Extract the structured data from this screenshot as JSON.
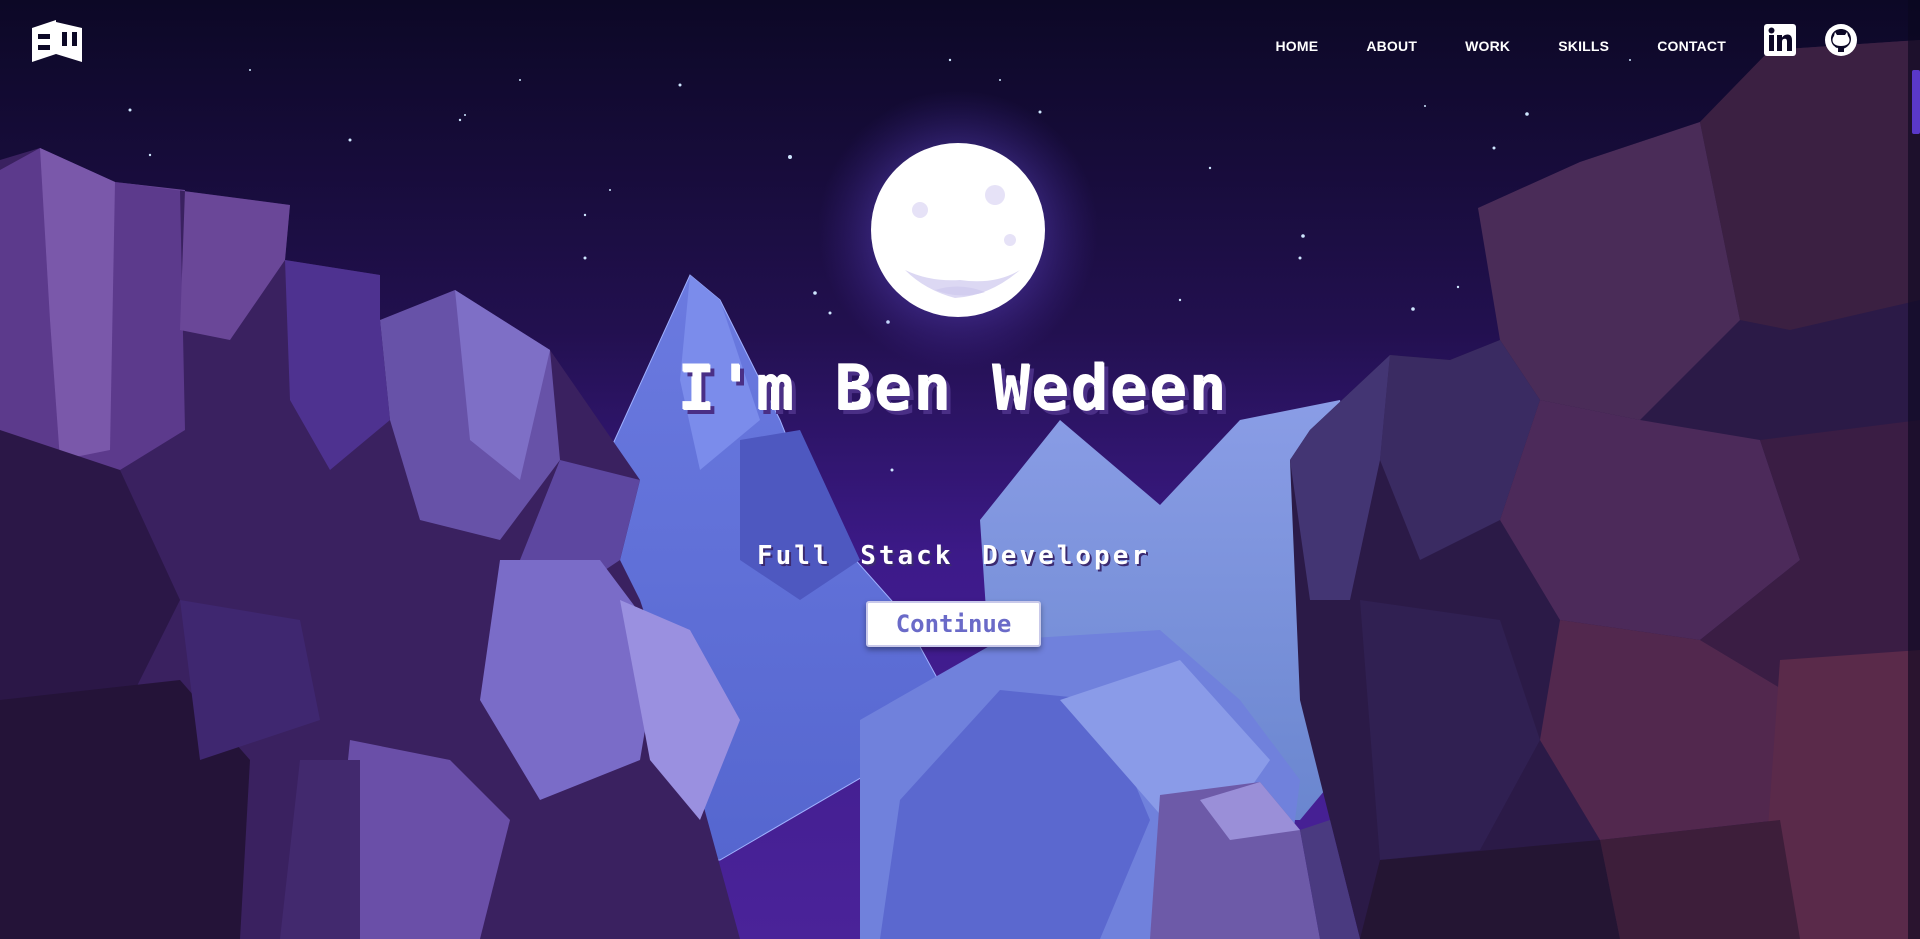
{
  "header": {
    "logo_text": "BW",
    "nav": [
      {
        "label": "HOME"
      },
      {
        "label": "ABOUT"
      },
      {
        "label": "WORK"
      },
      {
        "label": "SKILLS"
      },
      {
        "label": "CONTACT"
      }
    ],
    "social": [
      {
        "icon": "linkedin-icon",
        "label": "in"
      },
      {
        "icon": "github-icon"
      }
    ]
  },
  "hero": {
    "title": "I'm Ben Wedeen",
    "subtitle": "Full Stack Developer",
    "cta_label": "Continue"
  },
  "colors": {
    "sky_top": "#0c0826",
    "sky_bottom": "#3d1a8a",
    "moon": "#ffffff",
    "mountain": "#6c7ad6",
    "cliff_dark": "#2a1845",
    "cliff_purple": "#5d3b8e",
    "accent": "#6a6ac8"
  }
}
